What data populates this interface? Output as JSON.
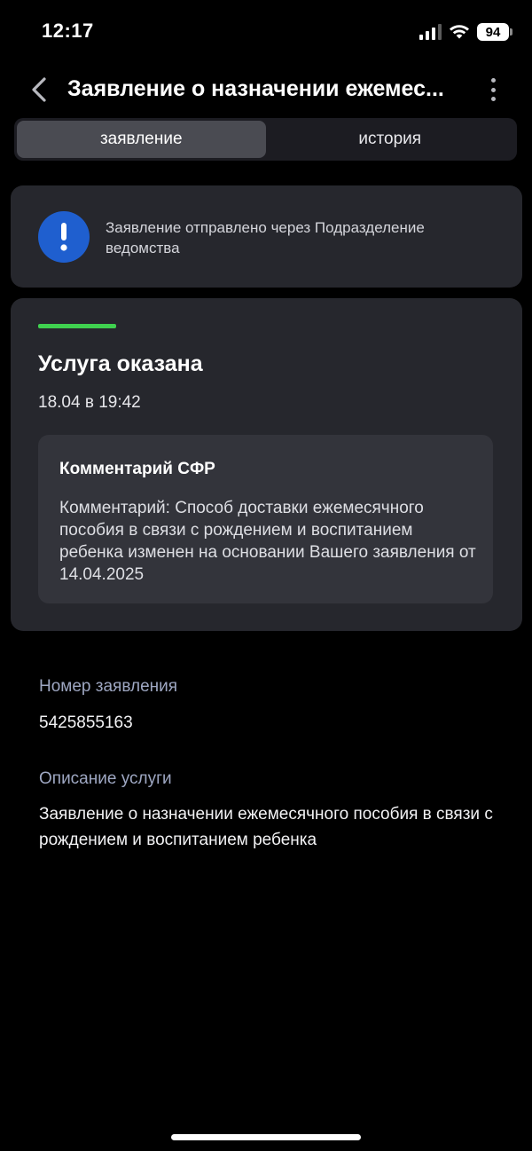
{
  "status_bar": {
    "time": "12:17",
    "battery_level": "94",
    "icons": [
      "cellular-signal-icon",
      "wifi-icon",
      "battery-icon"
    ]
  },
  "header": {
    "title": "Заявление о назначении ежемес...",
    "back_icon": "chevron-left-icon",
    "menu_icon": "more-vertical-icon"
  },
  "tabs": [
    {
      "label": "заявление",
      "active": true
    },
    {
      "label": "история",
      "active": false
    }
  ],
  "notice": {
    "icon": "exclamation-icon",
    "text": "Заявление отправлено через Подразделение ведомства"
  },
  "status_card": {
    "progress_fraction": 1.0,
    "title": "Услуга оказана",
    "date": "18.04 в 19:42",
    "comment": {
      "title": "Комментарий СФР",
      "text": "Комментарий: Способ доставки ежемесячного пособия в связи с рождением и воспитанием ребенка изменен на основании Вашего заявления от 14.04.2025"
    }
  },
  "details": {
    "application_number_label": "Номер заявления",
    "application_number": "5425855163",
    "service_description_label": "Описание услуги",
    "service_description": "Заявление о назначении ежемесячного пособия в связи с рождением и воспитанием ребенка"
  },
  "colors": {
    "background": "#000000",
    "card": "#26272d",
    "inner_card": "#33343b",
    "accent_blue": "#1f5fcf",
    "success_green": "#3fd14f",
    "label_muted": "#9ea7c2"
  }
}
